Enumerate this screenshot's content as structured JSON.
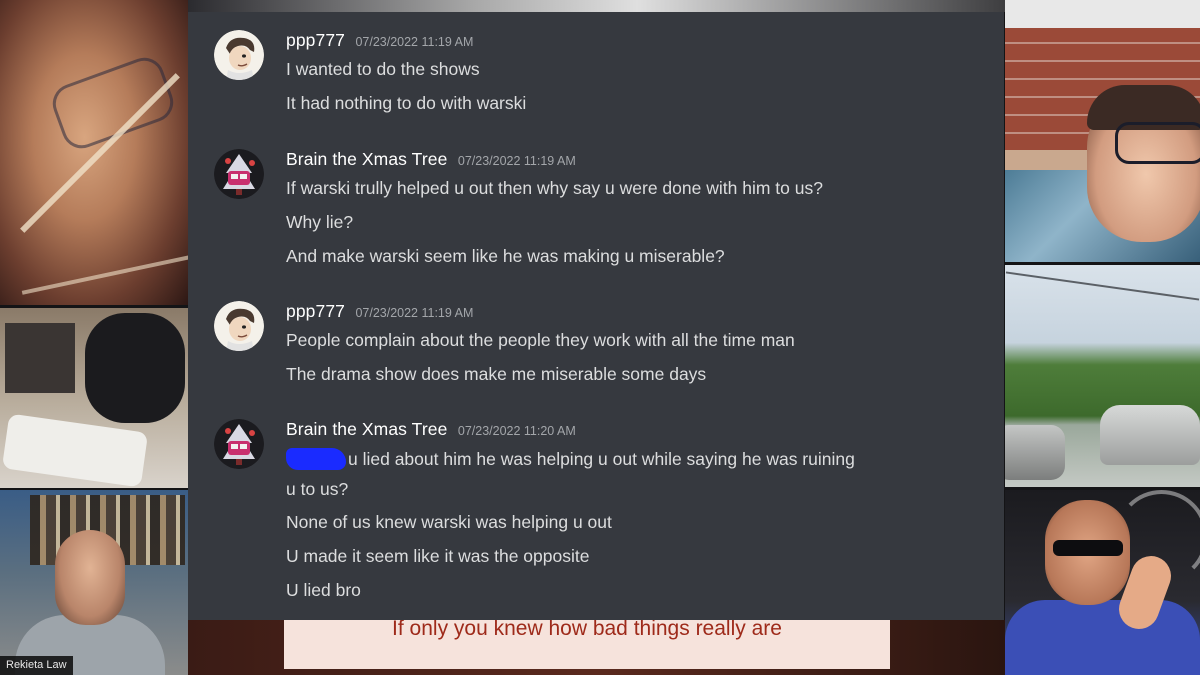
{
  "chat": {
    "messages": [
      {
        "author": "ppp777",
        "avatar": "cartoon-face-avatar",
        "timestamp": "07/23/2022 11:19 AM",
        "lines": [
          "I wanted to do the shows",
          "It had nothing to do with warski"
        ]
      },
      {
        "author": "Brain the Xmas Tree",
        "avatar": "xmas-tree-avatar",
        "timestamp": "07/23/2022 11:19 AM",
        "lines": [
          "If warski trully helped u out then why say u were done with him to us?",
          "Why lie?",
          "And make warski seem like he was making u miserable?"
        ]
      },
      {
        "author": "ppp777",
        "avatar": "cartoon-face-avatar",
        "timestamp": "07/23/2022 11:19 AM",
        "lines": [
          "People complain about the people they work with all the time man",
          "The drama show does make me miserable some days"
        ]
      },
      {
        "author": "Brain the Xmas Tree",
        "avatar": "xmas-tree-avatar",
        "timestamp": "07/23/2022 11:20 AM",
        "lines": [
          "u lied about him he was helping u out while saying he was ruining",
          "u to us?",
          "None of us knew warski was helping u out",
          "U made it seem like it was the opposite",
          "U lied bro"
        ]
      }
    ],
    "colors": {
      "background": "#36393f",
      "username": "#ffffff",
      "text": "#dcddde",
      "timestamp": "#a3a6aa",
      "redaction": "#1a2bff"
    }
  },
  "video": {
    "name_tag": "Rekieta Law",
    "caption": "If only you knew how bad things really are"
  }
}
